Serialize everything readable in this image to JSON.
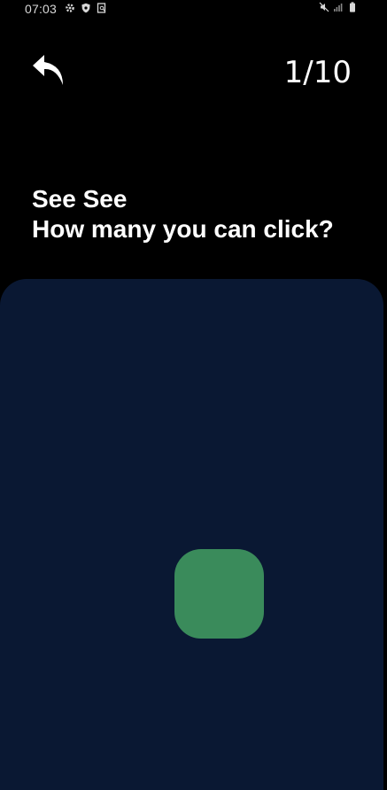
{
  "status_bar": {
    "time": "07:03",
    "left_icons": [
      "gear-icon",
      "shield-icon",
      "screenshot-icon"
    ],
    "right_icons": [
      "mute-icon",
      "signal-icon",
      "battery-icon"
    ]
  },
  "header": {
    "back_icon": "back-arrow-icon",
    "counter": "1/10"
  },
  "prompt": {
    "line1": "See See",
    "line2": "How many you can click?"
  },
  "colors": {
    "background": "#000000",
    "play_area": "#0a1833",
    "target": "#3a8b5b",
    "text": "#ffffff"
  }
}
